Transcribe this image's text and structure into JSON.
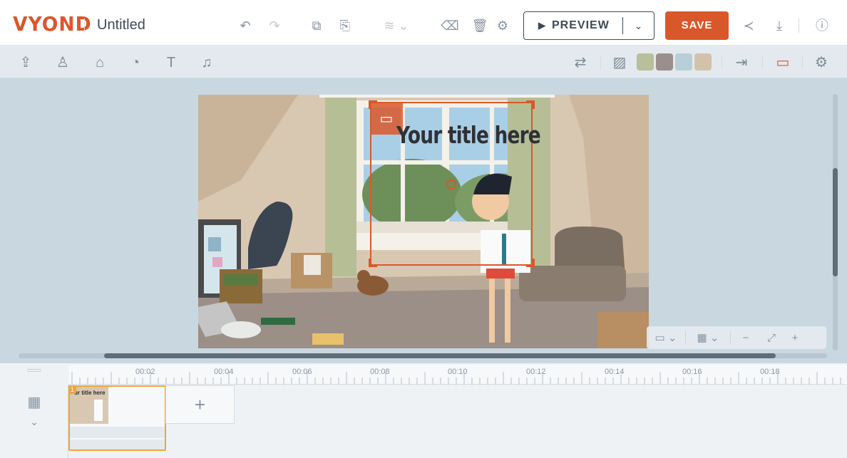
{
  "app": {
    "logo_text": "VYOND",
    "doc_title": "Untitled"
  },
  "toolbar": {
    "icons": [
      "undo-icon",
      "redo-icon",
      "duplicate-icon",
      "paste-icon",
      "layers-icon",
      "clear-icon",
      "trash-icon",
      "settings-icon"
    ],
    "preview_label": "PREVIEW",
    "save_label": "SAVE",
    "right_icons": [
      "share-icon",
      "download-icon",
      "help-icon"
    ]
  },
  "asset_bar": {
    "icons": [
      "upload-icon",
      "character-icon",
      "props-icon",
      "chart-icon",
      "text-icon",
      "audio-icon"
    ],
    "right_icons": [
      "swap-icon",
      "background-icon",
      "enter-icon",
      "camera-icon",
      "gear-icon"
    ],
    "swatches": [
      "#b9bf9b",
      "#9a8f8c",
      "#b8cfd8",
      "#d3c2aa"
    ]
  },
  "stage": {
    "title_text": "Your title here",
    "accent_color": "#d9582b"
  },
  "zoom_controls": {
    "minus": "−",
    "plus": "+"
  },
  "timeline": {
    "ticks": [
      "00:02",
      "00:04",
      "00:06",
      "00:08",
      "00:10",
      "00:12",
      "00:14",
      "00:16",
      "00:18"
    ],
    "scene_number": "1",
    "thumb_title": "ur title here",
    "add_scene_label": "+"
  }
}
